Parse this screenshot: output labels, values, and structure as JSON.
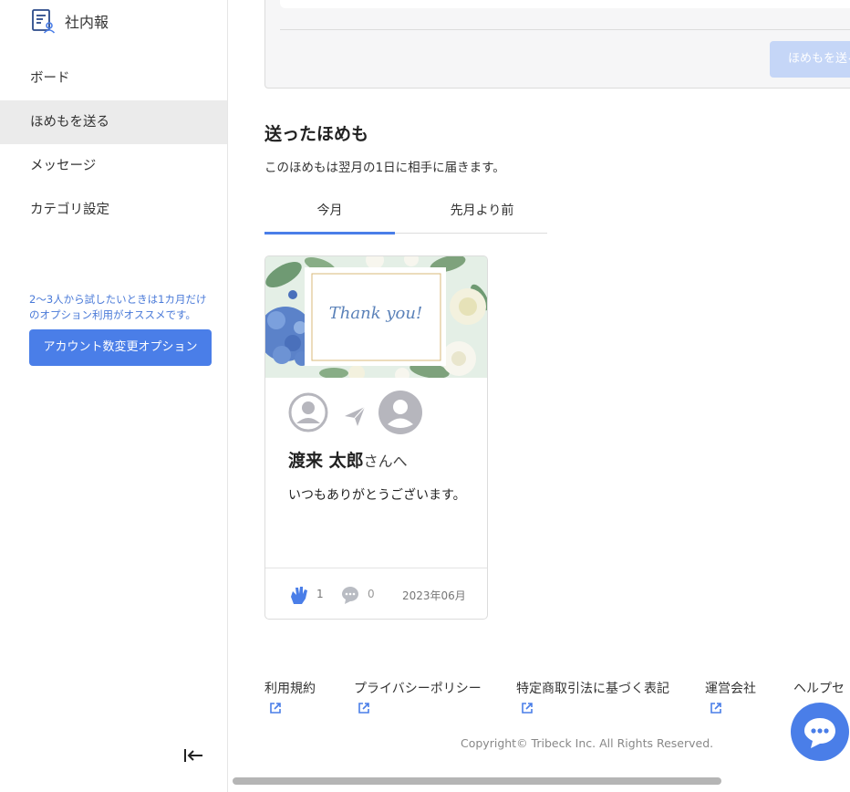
{
  "app": {
    "title": "社内報"
  },
  "sidebar": {
    "items": [
      {
        "label": "ボード"
      },
      {
        "label": "ほめもを送る"
      },
      {
        "label": "メッセージ"
      },
      {
        "label": "カテゴリ設定"
      }
    ],
    "promo_text": "2〜3人から試したいときは1カ月だけのオプション利用がオススメです。",
    "promo_button": "アカウント数変更オプション"
  },
  "form": {
    "send_button": "ほめもを送る"
  },
  "section": {
    "title": "送ったほめも",
    "description": "このほめもは翌月の1日に相手に届きます。"
  },
  "tabs": [
    {
      "label": "今月",
      "active": true
    },
    {
      "label": "先月より前",
      "active": false
    }
  ],
  "card": {
    "image_text": "Thank you!",
    "recipient_name": "渡来 太郎",
    "recipient_suffix": "さんへ",
    "message": "いつもありがとうございます。",
    "claps": "1",
    "comments": "0",
    "date": "2023年06月"
  },
  "footer": {
    "links": [
      {
        "label": "利用規約"
      },
      {
        "label": "プライバシーポリシー"
      },
      {
        "label": "特定商取引法に基づく表記"
      },
      {
        "label": "運営会社"
      },
      {
        "label": "ヘルプセ"
      }
    ],
    "copyright": "Copyright© Tribeck Inc. All Rights Reserved."
  },
  "colors": {
    "accent": "#4a7ee8",
    "disabled_button": "#c5d6f7",
    "promo_text": "#4a7ad8"
  },
  "icons": [
    "newsletter-icon",
    "collapse-sidebar-icon",
    "send-arrow-icon",
    "clap-icon",
    "comment-icon",
    "external-link-icon",
    "chat-icon",
    "avatar-icon"
  ]
}
